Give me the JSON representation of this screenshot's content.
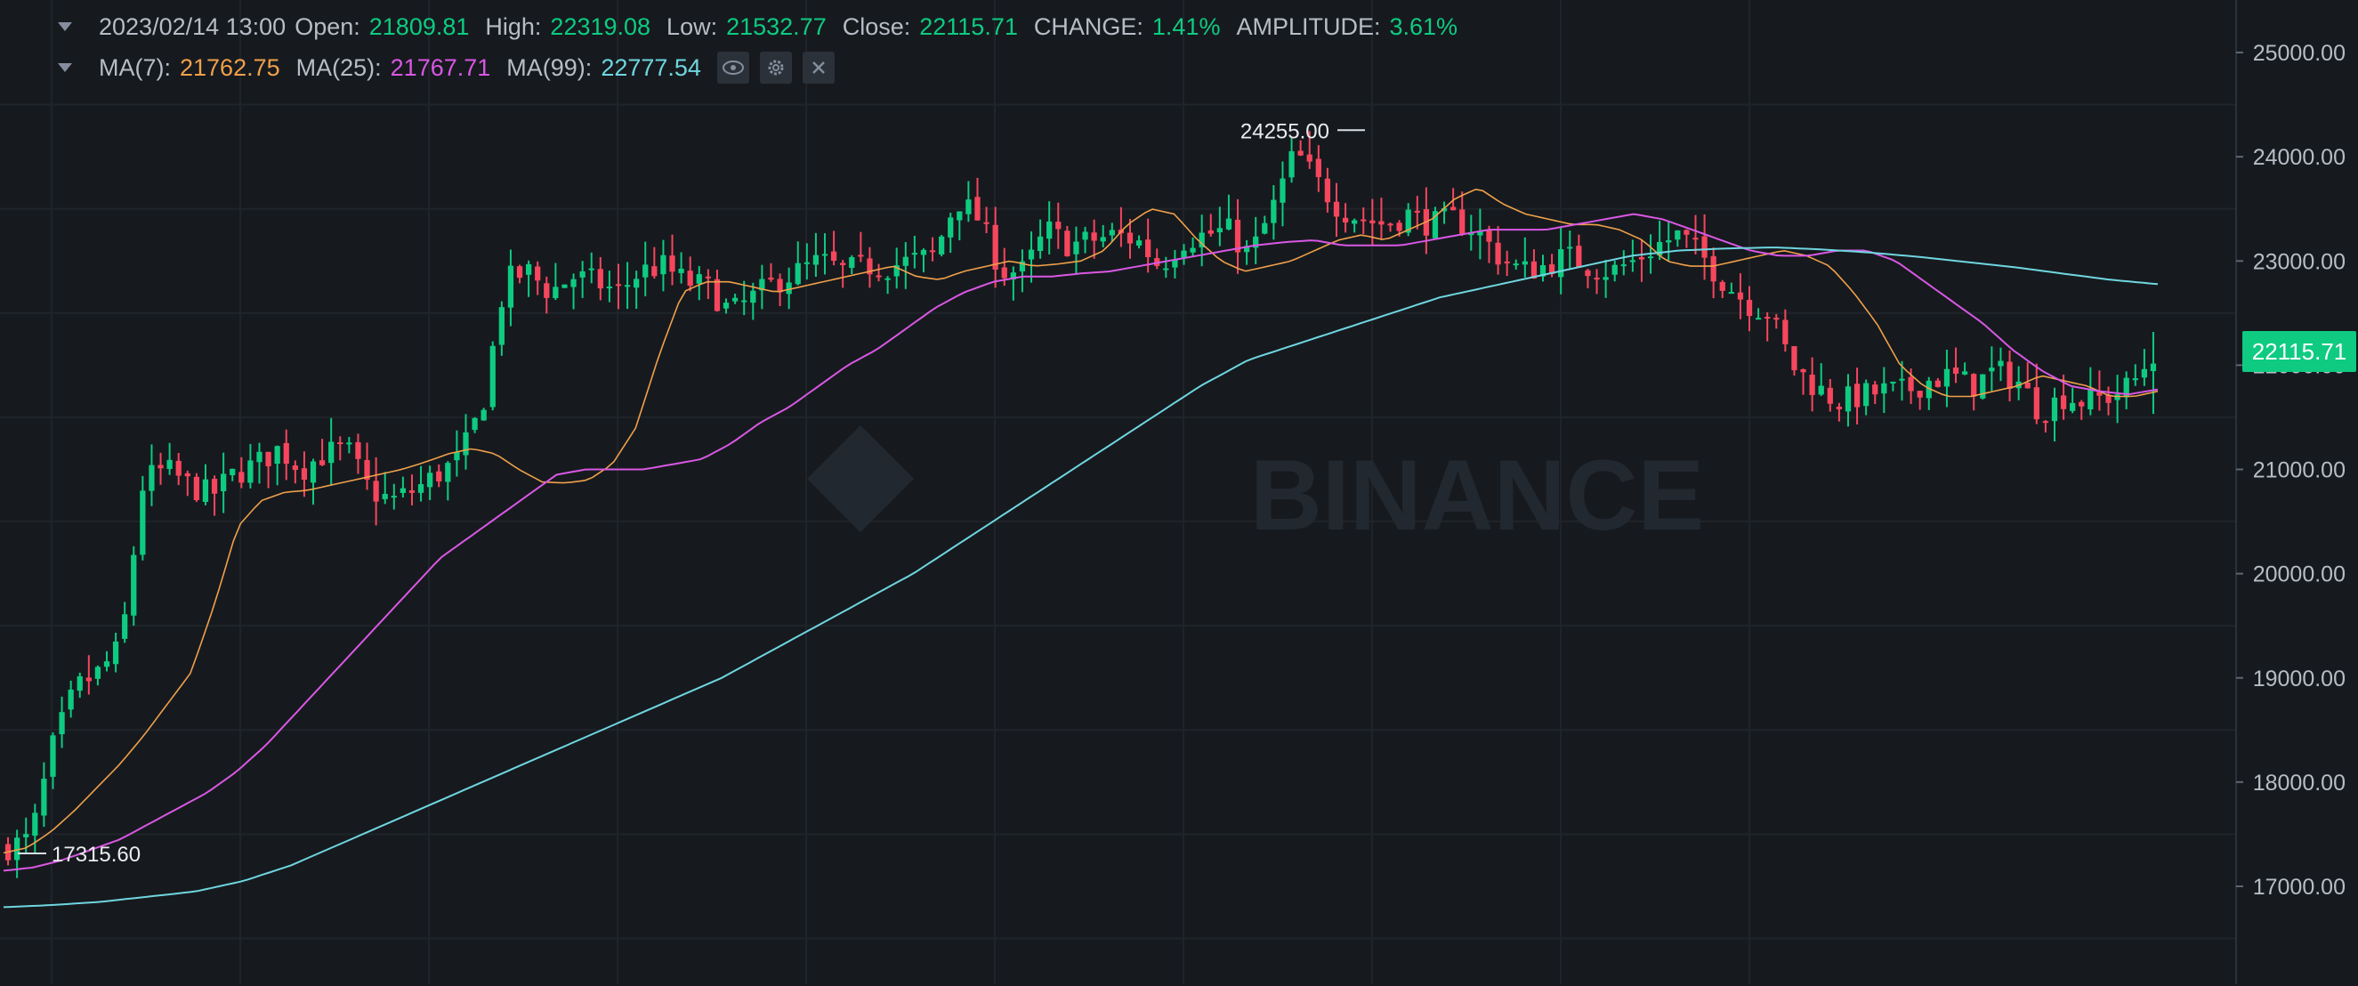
{
  "header": {
    "datetime": "2023/02/14 13:00",
    "open_label": "Open:",
    "open": "21809.81",
    "high_label": "High:",
    "high": "22319.08",
    "low_label": "Low:",
    "low": "21532.77",
    "close_label": "Close:",
    "close": "22115.71",
    "change_label": "CHANGE:",
    "change": "1.41%",
    "amplitude_label": "AMPLITUDE:",
    "amplitude": "3.61%"
  },
  "ma_row": {
    "ma7_label": "MA(7):",
    "ma7": "21762.75",
    "ma25_label": "MA(25):",
    "ma25": "21767.71",
    "ma99_label": "MA(99):",
    "ma99": "22777.54"
  },
  "icons": [
    "caret-down-icon",
    "eye-icon",
    "gear-icon",
    "close-icon"
  ],
  "watermark": "BINANCE",
  "current_price_tag": "22115.71",
  "colors": {
    "background": "#161a1e",
    "up": "#0ecb81",
    "down": "#f6465d",
    "ma7": "#f0a04b",
    "ma25": "#d957e4",
    "ma99": "#6fd6e0",
    "text_label": "#b7bdc6"
  },
  "chart_data": {
    "type": "candlestick",
    "y_axis_side": "right",
    "ylim": [
      16400,
      25500
    ],
    "y_ticks": [
      "25000.00",
      "24000.00",
      "23000.00",
      "22000.00",
      "21000.00",
      "20000.00",
      "19000.00",
      "18000.00",
      "17000.00"
    ],
    "y_tick_values": [
      25000,
      24000,
      23000,
      22000,
      21000,
      20000,
      19000,
      18000,
      17000
    ],
    "annotations": [
      {
        "text": "24255.00",
        "value": 24255,
        "type": "high"
      },
      {
        "text": "17315.60",
        "value": 17315.6,
        "type": "low"
      }
    ],
    "grid": true,
    "candle_count": 240,
    "close_path": [
      17380,
      17450,
      18350,
      18900,
      19050,
      19300,
      20900,
      21000,
      20850,
      20750,
      20950,
      21050,
      21200,
      21000,
      21150,
      21200,
      20800,
      20700,
      20800,
      20950,
      21100,
      21600,
      22800,
      22900,
      22700,
      22850,
      22800,
      22700,
      22900,
      22950,
      22800,
      22750,
      22500,
      22650,
      22800,
      22900,
      23000,
      22900,
      22950,
      22950,
      23000,
      23050,
      23600,
      23400,
      22900,
      22900,
      23300,
      23150,
      23200,
      23250,
      23200,
      22950,
      23200,
      23250,
      23300,
      23050,
      23500,
      24050,
      23750,
      23500,
      23400,
      23350,
      23450,
      23350,
      23400,
      23300,
      23050,
      22900,
      22950,
      23050,
      22950,
      22900,
      23000,
      23150,
      23250,
      23050,
      22800,
      22600,
      22500,
      22000,
      21800,
      21650,
      21700,
      21750,
      21750,
      21850,
      21900,
      21800,
      21950,
      21850,
      21550,
      21700,
      21650,
      21700,
      21800,
      22115.71
    ],
    "series": [
      {
        "name": "MA(7)",
        "last": 21762.75,
        "path": [
          17320,
          17370,
          17520,
          17720,
          17950,
          18180,
          18450,
          18750,
          19050,
          19700,
          20450,
          20700,
          20780,
          20800,
          20850,
          20900,
          20950,
          21000,
          21070,
          21150,
          21200,
          21150,
          21000,
          20880,
          20870,
          20900,
          21050,
          21400,
          22100,
          22700,
          22800,
          22800,
          22750,
          22700,
          22750,
          22800,
          22850,
          22900,
          22950,
          22850,
          22820,
          22900,
          22950,
          23000,
          22950,
          22970,
          23000,
          23100,
          23350,
          23500,
          23450,
          23200,
          23000,
          22900,
          22950,
          23000,
          23100,
          23200,
          23250,
          23200,
          23300,
          23400,
          23600,
          23700,
          23550,
          23450,
          23400,
          23350,
          23350,
          23300,
          23200,
          23000,
          22950,
          22950,
          23000,
          23050,
          23100,
          23050,
          22950,
          22700,
          22400,
          22000,
          21800,
          21700,
          21700,
          21750,
          21800,
          21900,
          21850,
          21800,
          21700,
          21700,
          21750
        ]
      },
      {
        "name": "MA(25)",
        "last": 21767.71,
        "path": [
          17150,
          17180,
          17250,
          17350,
          17450,
          17600,
          17750,
          17900,
          18100,
          18350,
          18650,
          18950,
          19250,
          19550,
          19850,
          20150,
          20350,
          20550,
          20750,
          20950,
          21000,
          21000,
          21000,
          21050,
          21100,
          21250,
          21450,
          21600,
          21800,
          22000,
          22150,
          22350,
          22550,
          22700,
          22800,
          22850,
          22850,
          22880,
          22900,
          22950,
          23000,
          23050,
          23100,
          23150,
          23180,
          23200,
          23150,
          23150,
          23150,
          23200,
          23250,
          23300,
          23300,
          23300,
          23350,
          23400,
          23450,
          23400,
          23300,
          23200,
          23100,
          23050,
          23050,
          23100,
          23100,
          23000,
          22800,
          22600,
          22400,
          22150,
          21950,
          21800,
          21750,
          21720,
          21767.71
        ]
      },
      {
        "name": "MA(99)",
        "last": 22777.54,
        "path": [
          16800,
          16820,
          16850,
          16900,
          16950,
          17050,
          17200,
          17400,
          17600,
          17800,
          18000,
          18200,
          18400,
          18600,
          18800,
          19000,
          19250,
          19500,
          19750,
          20000,
          20300,
          20600,
          20900,
          21200,
          21500,
          21800,
          22050,
          22200,
          22350,
          22500,
          22650,
          22750,
          22850,
          22950,
          23050,
          23100,
          23120,
          23130,
          23110,
          23080,
          23040,
          22990,
          22940,
          22880,
          22820,
          22777.54
        ]
      }
    ]
  }
}
